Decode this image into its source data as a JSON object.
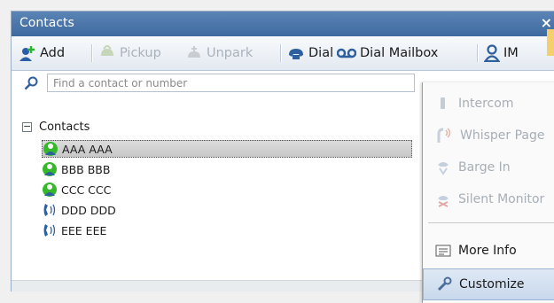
{
  "window": {
    "title": "Contacts",
    "close_label": "×"
  },
  "toolbar": {
    "add": "Add",
    "pickup": "Pickup",
    "unpark": "Unpark",
    "dial": "Dial",
    "dial_mailbox": "Dial Mailbox",
    "im": "IM"
  },
  "search": {
    "placeholder": "Find a contact or number"
  },
  "tree": {
    "root_label": "Contacts",
    "items": [
      {
        "name": "AAA AAA",
        "icon": "presence-green-icon",
        "selected": true
      },
      {
        "name": "BBB BBB",
        "icon": "presence-green-icon",
        "selected": false
      },
      {
        "name": "CCC CCC",
        "icon": "presence-green-icon",
        "selected": false
      },
      {
        "name": "DDD DDD",
        "icon": "ringing-phone-icon",
        "selected": false
      },
      {
        "name": "EEE EEE",
        "icon": "ringing-phone-icon",
        "selected": false
      }
    ]
  },
  "context_menu": {
    "items": [
      {
        "label": "Intercom",
        "enabled": false
      },
      {
        "label": "Whisper Page",
        "enabled": false
      },
      {
        "label": "Barge In",
        "enabled": false
      },
      {
        "label": "Silent Monitor",
        "enabled": false
      },
      {
        "label": "More Info",
        "enabled": true
      },
      {
        "label": "Customize",
        "enabled": true
      }
    ]
  },
  "colors": {
    "title_bar": "#4a74aa",
    "selection": "#d0d0d0",
    "presence": "#35b82a"
  }
}
